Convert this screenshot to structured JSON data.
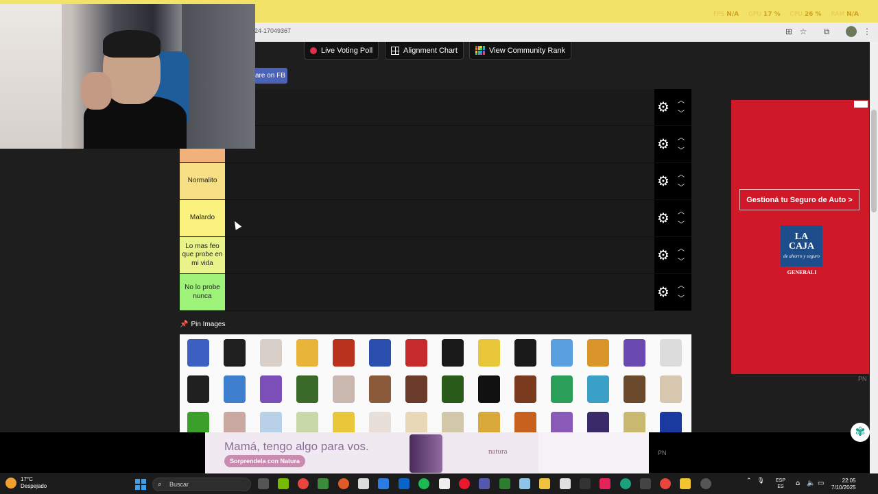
{
  "browser": {
    "url_fragment": "24-17049367",
    "overlay_stats": {
      "fps_label": "FPS",
      "fps_value": "N/A",
      "gpu_label": "GPU",
      "gpu_value": "17 %",
      "cpu_label": "CPU",
      "cpu_value": "26 %",
      "ram_label": "RAM",
      "ram_value": "N/A"
    }
  },
  "top_buttons": {
    "live_voting": "Live Voting Poll",
    "alignment": "Alignment Chart",
    "community": "View Community Rank",
    "share_fb": "are on FB"
  },
  "tiers": [
    {
      "label": "",
      "color": "#f0b27a",
      "hidden": true
    },
    {
      "label": "",
      "color": "#f0b27a",
      "hidden": true
    },
    {
      "label": "",
      "color": "#f4be8a"
    },
    {
      "label": "Normalito",
      "color": "#f7df86"
    },
    {
      "label": "Malardo",
      "color": "#fbf17e"
    },
    {
      "label": "Lo mas feo que probe en mi vida",
      "color": "#e9f38a"
    },
    {
      "label": "No lo probe nunca",
      "color": "#9ef27a"
    }
  ],
  "pin_images": {
    "label": "Pin Images",
    "rows": [
      [
        "#3e5fc2",
        "#1f1f1f",
        "#d8d0c8",
        "#e8b43a",
        "#b8321e",
        "#2b4fae",
        "#c62a2a",
        "#1a1a1a",
        "#e8c83a",
        "#1a1a1a",
        "#5aa0e0",
        "#d9942a",
        "#6a4ab0",
        "#dcdcdc"
      ],
      [
        "#202020",
        "#3f7fd0",
        "#7a4fb8",
        "#3a6a2a",
        "#c8b8b0",
        "#8a5a3a",
        "#6a3a2a",
        "#2a5a1a",
        "#111111",
        "#7a3a1e",
        "#2aa05a",
        "#3aa0c8",
        "#6a4a2a",
        "#d8c8b0"
      ],
      [
        "#3aa02a",
        "#c8a8a0",
        "#b8d0e8",
        "#c8d8a8",
        "#e8c83a",
        "#e8e0d8",
        "#e8d8b8",
        "#d0c8a8",
        "#d8a83a",
        "#c8601e",
        "#8a5ab8",
        "#3a2a6a",
        "#c8b870",
        "#1a3aa0"
      ]
    ]
  },
  "ad_right": {
    "cta": "Gestioná tu Seguro de Auto >",
    "logo_line1": "LA",
    "logo_line2": "CAJA",
    "logo_sub": "de ahorro y seguro",
    "generali": "GENERALI",
    "pn": "PN"
  },
  "ad_bottom": {
    "message": "Mamá, tengo algo para vos.",
    "sub": "Sorprendela con Natura",
    "brand": "natura",
    "pn": "PN"
  },
  "taskbar": {
    "temperature": "17°C",
    "condition": "Despejado",
    "search": "Buscar",
    "lang_top": "ESP",
    "lang_bottom": "ES",
    "time": "22:05",
    "date": "7/10/2025"
  }
}
